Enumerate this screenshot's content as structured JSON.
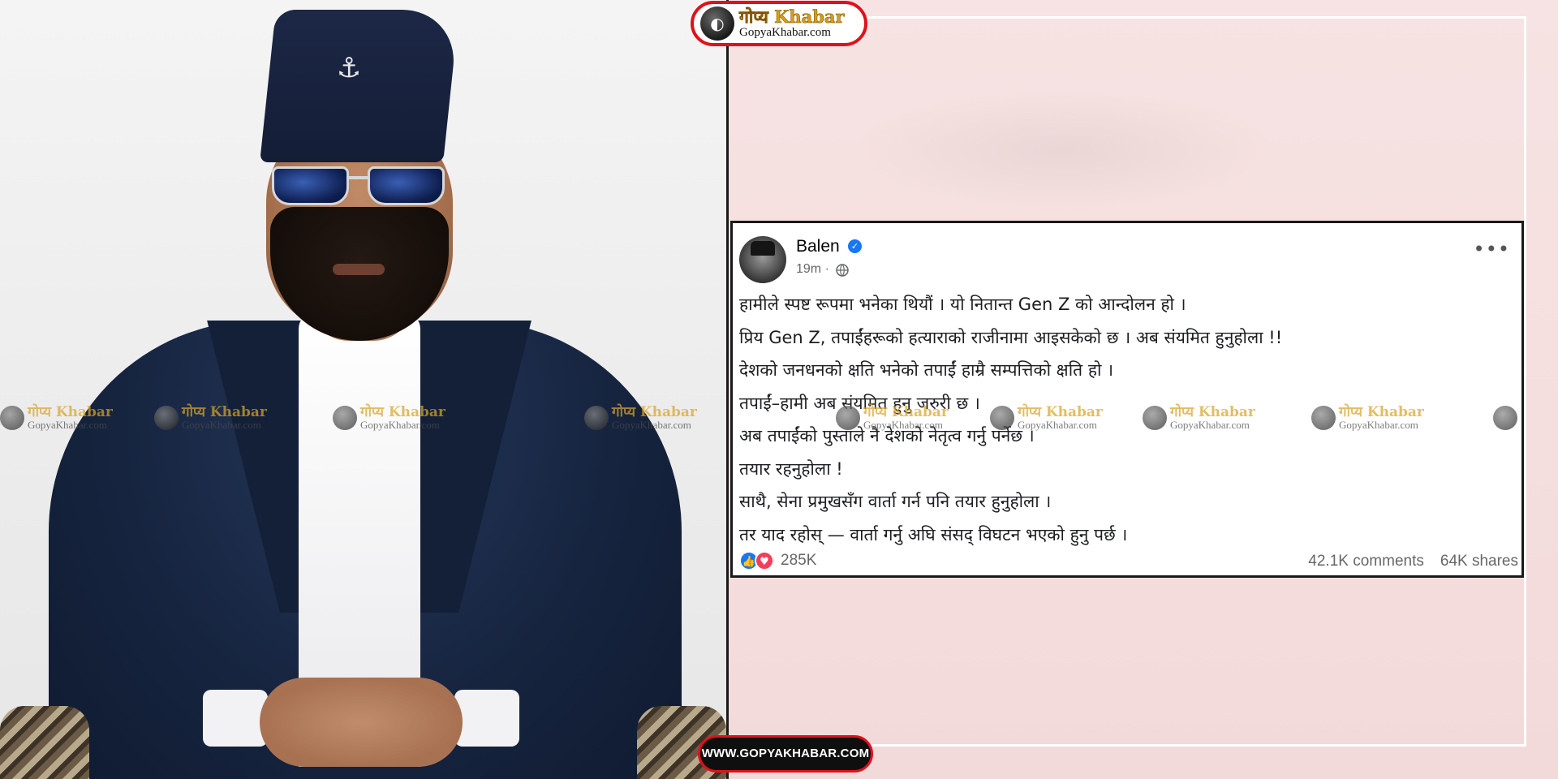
{
  "logo": {
    "title": "गोप्य Khabar",
    "subtitle": "GopyaKhabar.com"
  },
  "post": {
    "author": "Balen",
    "verified": true,
    "time": "19m ·",
    "privacy_icon": "globe-icon",
    "more_icon": "more-options-icon",
    "more_glyph": "•••",
    "lines": [
      "हामीले स्पष्ट रूपमा भनेका थियौं । यो नितान्त Gen Z को आन्दोलन हो ।",
      "प्रिय Gen Z, तपाईंहरूको हत्याराको राजीनामा आइसकेको छ । अब संयमित हुनुहोला !!",
      "देशको जनधनको क्षति भनेको तपाईं हाम्रै सम्पत्तिको क्षति हो ।",
      "तपाईं–हामी अब संयमित हुनु जरुरी छ ।",
      "अब तपाईंको पुस्ताले नै देशको नेतृत्व गर्नु पर्नेछ ।",
      "तयार रहनुहोला !",
      "साथै, सेना प्रमुखसँग वार्ता गर्न पनि  तयार हुनुहोला ।",
      "तर याद रहोस् — वार्ता गर्नु अघि संसद् विघटन भएको हुनु पर्छ ।"
    ],
    "reaction_count": "285K",
    "comments": "42.1K comments",
    "shares": "64K shares"
  },
  "watermark": {
    "title": "गोप्य Khabar",
    "subtitle": "GopyaKhabar.com"
  },
  "url_badge": "WWW.GOPYAKHABAR.COM",
  "colors": {
    "brand_red": "#e0111b",
    "brand_gold": "#d4a017",
    "facebook_blue": "#1877f2",
    "love_red": "#f33e58",
    "background_pink": "#f3dcdc"
  }
}
